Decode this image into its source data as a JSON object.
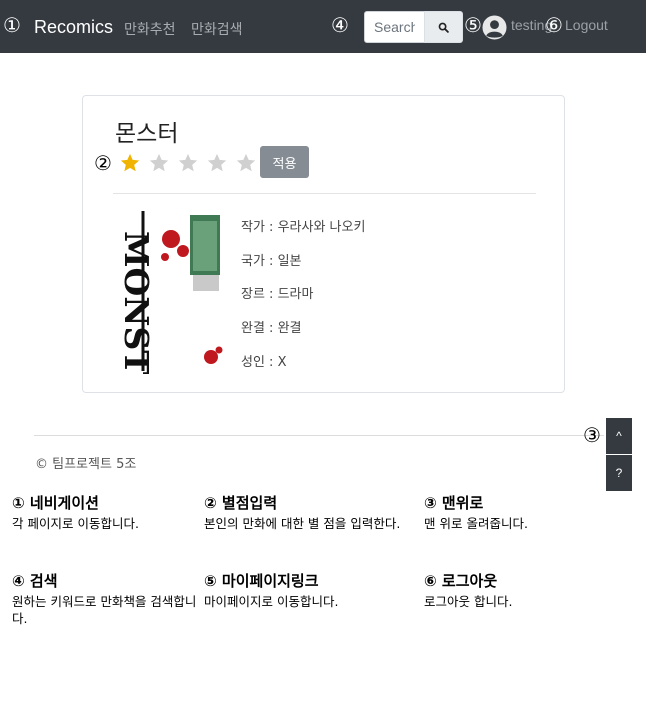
{
  "navbar": {
    "brand": "Recomics",
    "links": [
      "만화추천",
      "만화검색"
    ],
    "search_placeholder": "Search",
    "username": "testing",
    "logout": "Logout",
    "markers": [
      "①",
      "④",
      "⑤",
      "⑥"
    ]
  },
  "comic": {
    "title": "몬스터",
    "rating": 1,
    "max_rating": 5,
    "apply_button": "적용",
    "rating_marker": "②",
    "info": [
      "작가 : 우라사와 나오키",
      "국가 : 일본",
      "장르 : 드라마",
      "완결 : 완결",
      "성인 : X"
    ],
    "cover_text": "MONSTER"
  },
  "footer": {
    "copyright": "© 팀프로젝트 5조",
    "top_button": "^",
    "help_button": "?",
    "top_marker": "③"
  },
  "legend": [
    {
      "title": "① 네비게이션",
      "desc": "각 페이지로 이동합니다."
    },
    {
      "title": "② 별점입력",
      "desc": "본인의 만화에 대한 별 점을 입력한다."
    },
    {
      "title": "③ 맨위로",
      "desc": "맨 위로 올려줍니다."
    },
    {
      "title": "④ 검색",
      "desc": "원하는 키워드로 만화책을 검색합니다."
    },
    {
      "title": "⑤ 마이페이지링크",
      "desc": "마이페이지로 이동합니다."
    },
    {
      "title": "⑥ 로그아웃",
      "desc": "로그아웃 합니다."
    }
  ],
  "colors": {
    "navbar_bg": "#343a40",
    "star_filled": "#f0b400",
    "star_empty": "#d0d0d0",
    "apply_button": "#858c94"
  }
}
